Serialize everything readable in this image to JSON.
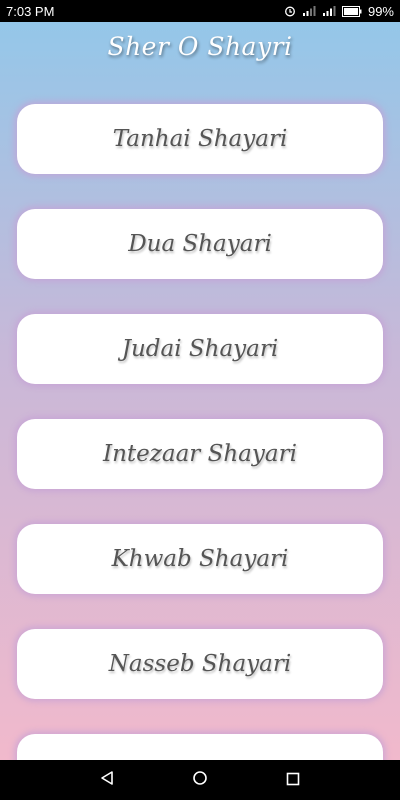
{
  "status_bar": {
    "time": "7:03 PM",
    "battery": "99%",
    "icons": [
      "alarm-icon",
      "signal-icon",
      "signal-icon",
      "battery-icon"
    ]
  },
  "app": {
    "title": "Sher O Shayri"
  },
  "menu": {
    "items": [
      {
        "label": "Tanhai Shayari"
      },
      {
        "label": "Dua Shayari"
      },
      {
        "label": "Judai Shayari"
      },
      {
        "label": "Intezaar Shayari"
      },
      {
        "label": "Khwab Shayari"
      },
      {
        "label": "Nasseb Shayari"
      },
      {
        "label": ""
      }
    ]
  },
  "nav": {
    "icons": [
      "back-icon",
      "home-icon",
      "recents-icon"
    ]
  },
  "colors": {
    "gradient_top": "#94c7e9",
    "gradient_bottom": "#f1b9cc",
    "card_glow": "#c4a0d6",
    "label_text": "#555555"
  }
}
